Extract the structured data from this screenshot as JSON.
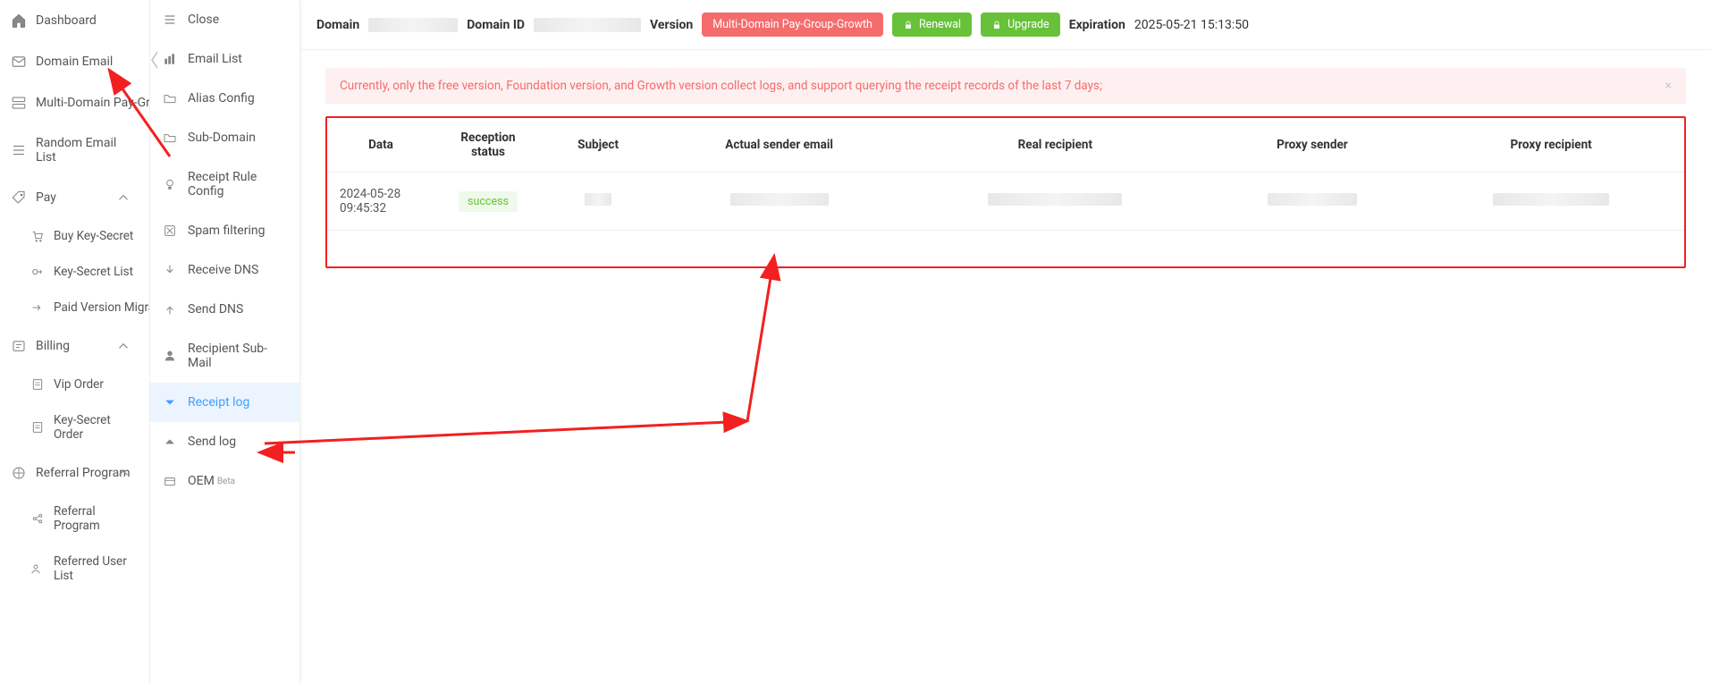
{
  "sidebar": {
    "dashboard": "Dashboard",
    "domain_email": "Domain Email",
    "multi_domain_pay_group": "Multi-Domain Pay-Group",
    "random_email_list": "Random Email List",
    "pay": "Pay",
    "pay_children": {
      "buy_key_secret": "Buy Key-Secret",
      "key_secret_list": "Key-Secret List",
      "paid_version_migration": "Paid Version Migration"
    },
    "billing": "Billing",
    "billing_children": {
      "vip_order": "Vip Order",
      "key_secret_order": "Key-Secret Order"
    },
    "referral_program": "Referral Program",
    "referral_children": {
      "referral_program": "Referral Program",
      "referred_user_list": "Referred User List"
    }
  },
  "submenu": {
    "close": "Close",
    "email_list": "Email List",
    "alias_config": "Alias Config",
    "sub_domain": "Sub-Domain",
    "receipt_rule_config": "Receipt Rule Config",
    "spam_filtering": "Spam filtering",
    "receive_dns": "Receive DNS",
    "send_dns": "Send DNS",
    "recipient_sub_mail": "Recipient Sub-Mail",
    "receipt_log": "Receipt log",
    "send_log": "Send log",
    "oem": "OEM",
    "oem_beta": "Beta"
  },
  "header": {
    "domain_label": "Domain",
    "domain_id_label": "Domain ID",
    "version_label": "Version",
    "version_tag": "Multi-Domain Pay-Group-Growth",
    "renewal": "Renewal",
    "upgrade": "Upgrade",
    "expiration_label": "Expiration",
    "expiration_value": "2025-05-21 15:13:50"
  },
  "alert": {
    "text": "Currently, only the free version, Foundation version, and Growth version collect logs, and support querying the receipt records of the last 7 days;",
    "close": "×"
  },
  "table": {
    "headers": {
      "data": "Data",
      "reception_status": "Reception status",
      "subject": "Subject",
      "actual_sender": "Actual sender email",
      "real_recipient": "Real recipient",
      "proxy_sender": "Proxy sender",
      "proxy_recipient": "Proxy recipient"
    },
    "rows": [
      {
        "data": "2024-05-28 09:45:32",
        "status": "success"
      }
    ]
  }
}
